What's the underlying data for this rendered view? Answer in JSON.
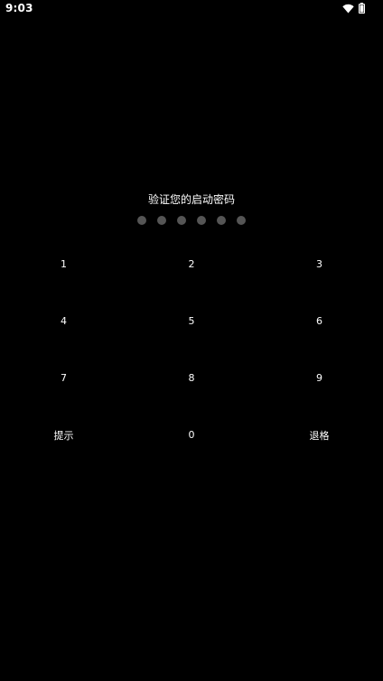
{
  "status_bar": {
    "time": "9:03",
    "icons": [
      "wifi-icon",
      "battery-icon"
    ]
  },
  "lock_screen": {
    "prompt": "验证您的启动密码",
    "pin_length": 6,
    "entered_digits": 0,
    "dot_color": "#555555"
  },
  "keypad": {
    "keys": [
      [
        "1",
        "2",
        "3"
      ],
      [
        "4",
        "5",
        "6"
      ],
      [
        "7",
        "8",
        "9"
      ],
      [
        "提示",
        "0",
        "退格"
      ]
    ]
  },
  "colors": {
    "background": "#000000",
    "text": "#ffffff"
  }
}
